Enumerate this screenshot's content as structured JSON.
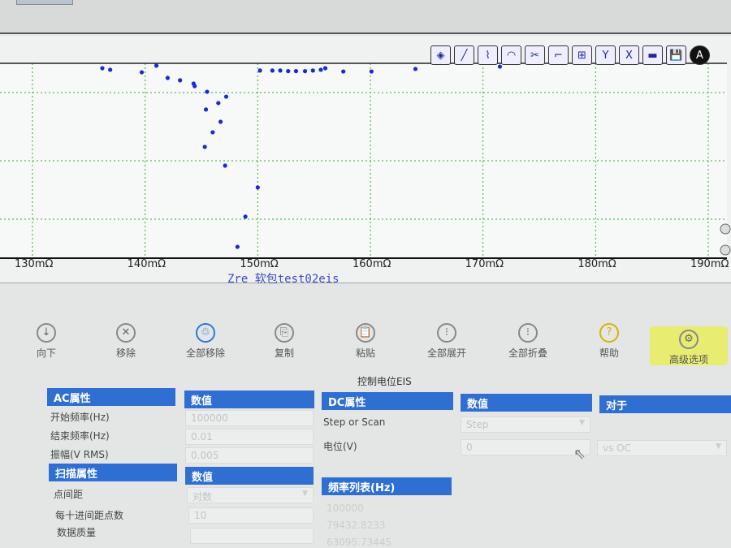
{
  "toolbar_icons": [
    "zoom-fit-icon",
    "line-icon",
    "curve-icon",
    "arc-fit-icon",
    "scissors-icon",
    "step-icon",
    "xy-axis-icon",
    "y-axis-icon",
    "x-axis-icon",
    "color-bar-icon",
    "save-icon",
    "auto-scale-icon"
  ],
  "auto_label": "A",
  "chart_data": {
    "type": "scatter",
    "xlabel": "Zre  软包test02eis",
    "x_ticks": [
      "130mΩ",
      "140mΩ",
      "150mΩ",
      "160mΩ",
      "170mΩ",
      "180mΩ",
      "190mΩ"
    ],
    "xlim": [
      130,
      190
    ],
    "ylim": [
      0,
      100
    ],
    "y_units": "relative (axis unlabeled)",
    "grid": true,
    "color": "#1a2ad0",
    "points": [
      [
        136.2,
        97.5
      ],
      [
        136.9,
        96.7
      ],
      [
        139.7,
        95.4
      ],
      [
        141.0,
        98.8
      ],
      [
        142.0,
        92.5
      ],
      [
        143.1,
        91.3
      ],
      [
        144.3,
        89.6
      ],
      [
        144.4,
        88.3
      ],
      [
        145.5,
        85.4
      ],
      [
        146.5,
        79.6
      ],
      [
        147.2,
        82.9
      ],
      [
        145.4,
        76.3
      ],
      [
        146.7,
        70
      ],
      [
        146.0,
        64.6
      ],
      [
        145.3,
        57.1
      ],
      [
        147.1,
        47.5
      ],
      [
        150.0,
        36.3
      ],
      [
        148.9,
        21.3
      ],
      [
        148.2,
        5.8
      ],
      [
        150.2,
        96.3
      ],
      [
        151.3,
        96.3
      ],
      [
        152.0,
        96.3
      ],
      [
        152.7,
        96.0
      ],
      [
        153.4,
        96.0
      ],
      [
        154.2,
        96.0
      ],
      [
        154.9,
        96.3
      ],
      [
        155.6,
        96.7
      ],
      [
        156.0,
        97.5
      ],
      [
        157.6,
        95.8
      ],
      [
        160.1,
        95.8
      ],
      [
        164.0,
        97.1
      ],
      [
        171.5,
        98.3
      ]
    ]
  },
  "buttons": [
    {
      "label": "向下",
      "icon": "↓"
    },
    {
      "label": "移除",
      "icon": "✕"
    },
    {
      "label": "全部移除",
      "icon": "♲"
    },
    {
      "label": "复制",
      "icon": "⎘"
    },
    {
      "label": "粘贴",
      "icon": "📋"
    },
    {
      "label": "全部展开",
      "icon": "⁝"
    },
    {
      "label": "全部折叠",
      "icon": "⁝"
    },
    {
      "label": "帮助",
      "icon": "?"
    },
    {
      "label": "高级选项",
      "icon": "⚙"
    }
  ],
  "section_title": "控制电位EIS",
  "ac": {
    "header": "AC属性",
    "value_header": "数值",
    "rows": [
      {
        "label": "开始频率(Hz)",
        "value": "100000"
      },
      {
        "label": "结束频率(Hz)",
        "value": "0.01"
      },
      {
        "label": "振幅(V RMS)",
        "value": "0.005"
      }
    ]
  },
  "scan": {
    "header": "扫描属性",
    "value_header": "数值",
    "rows": [
      {
        "label": "点间距",
        "value": "对数"
      },
      {
        "label": "每十进间距点数",
        "value": "10"
      },
      {
        "label": "数据质量",
        "value": ""
      }
    ]
  },
  "dc": {
    "header": "DC属性",
    "value_header": "数值",
    "vs_header": "对于",
    "rows": [
      {
        "label": "Step or Scan",
        "value": "Step"
      },
      {
        "label": "电位(V)",
        "value": "0",
        "vs": "vs OC"
      }
    ]
  },
  "freq_list": {
    "header": "频率列表(Hz)",
    "items": [
      "100000",
      "79432.8233",
      "63095.73445"
    ]
  }
}
